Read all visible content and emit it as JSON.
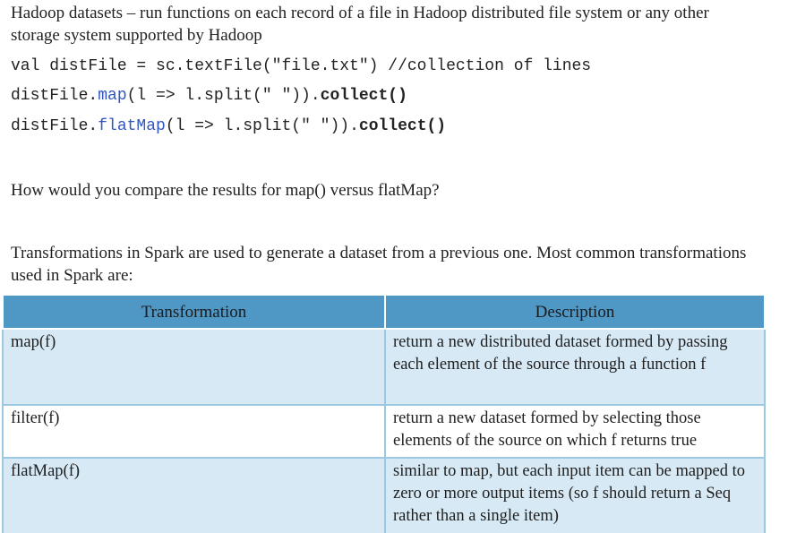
{
  "intro": "Hadoop datasets – run functions on each record of a file in Hadoop distributed file system or any other storage system supported by Hadoop",
  "code": {
    "line1": "val distFile = sc.textFile(\"file.txt\") //collection of lines",
    "line2": {
      "prefix": "distFile.",
      "method": "map",
      "args": "(l => l.split(\" \")).",
      "call": "collect()"
    },
    "line3": {
      "prefix": "distFile.",
      "method": "flatMap",
      "args": "(l => l.split(\" \")).",
      "call": "collect()"
    }
  },
  "question": "How would you compare the results for map() versus flatMap?",
  "transform_intro": "Transformations in Spark are used to generate a dataset from a previous one. Most common transformations used in Spark are:",
  "table": {
    "headers": [
      "Transformation",
      "Description"
    ],
    "rows": [
      {
        "name": "map(f)",
        "desc": "return a new distributed dataset formed by passing  each element of the source through a function f"
      },
      {
        "name": "filter(f)",
        "desc": "return a new dataset formed by selecting those elements of the source on which f returns true"
      },
      {
        "name": "flatMap(f)",
        "desc": "similar to map, but each input item can be mapped to zero or more output items (so f should return a Seq rather than a single item)"
      }
    ]
  },
  "colors": {
    "header_bg": "#4f98c6",
    "row_shade": "#d7e9f5",
    "code_keyword": "#2f56c4"
  }
}
